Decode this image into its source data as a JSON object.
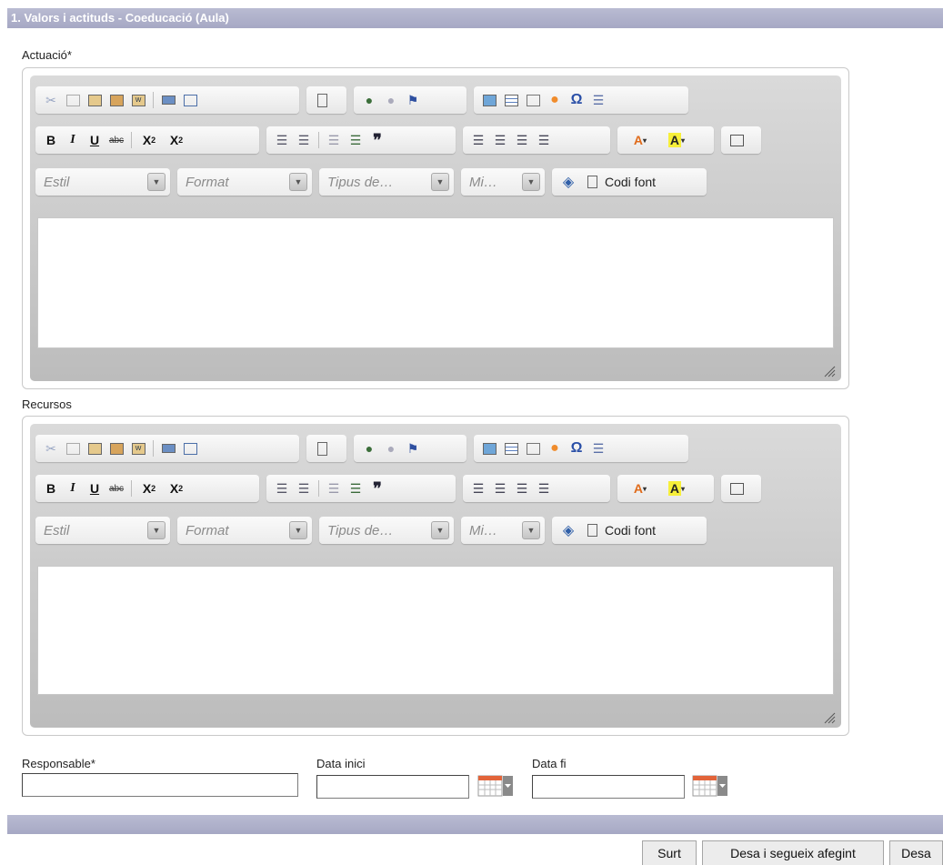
{
  "section": {
    "title": "1. Valors i actituds - Coeducació (Aula)"
  },
  "fields": {
    "actuacio_label": "Actuació*",
    "recursos_label": "Recursos",
    "responsable_label": "Responsable*",
    "data_inici_label": "Data inici",
    "data_fi_label": "Data fi",
    "responsable_value": "",
    "data_inici_value": "",
    "data_fi_value": ""
  },
  "editor": {
    "combos": {
      "style": "Estil",
      "format": "Format",
      "font": "Tipus de…",
      "size": "Mi…"
    },
    "source_label": "Codi font"
  },
  "buttons": {
    "exit": "Surt",
    "save_continue": "Desa i segueix afegint",
    "save": "Desa"
  },
  "colors": {
    "header_bar": "#a9abc7",
    "toolbar_bg": "#c9c9c9",
    "accent_text": "#ffffff"
  }
}
